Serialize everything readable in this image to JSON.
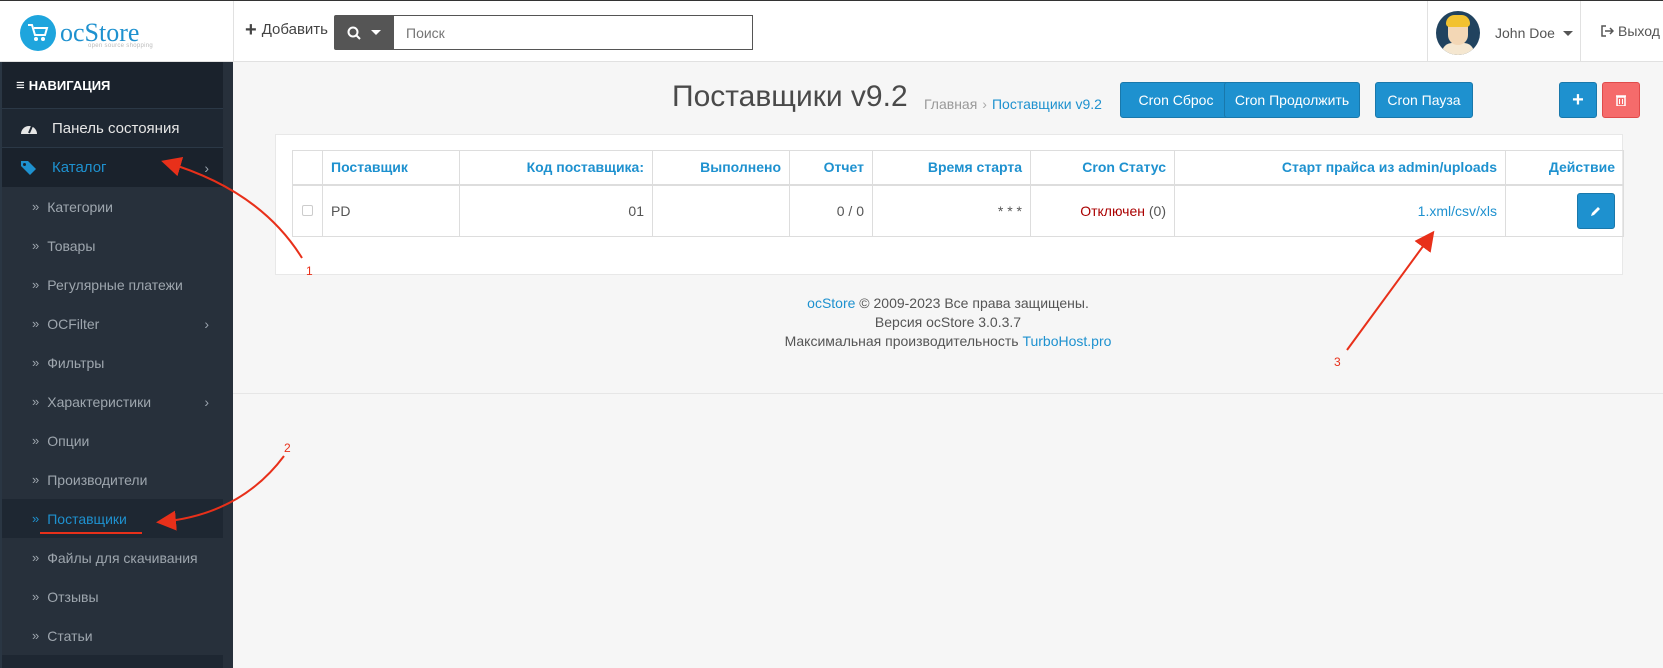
{
  "header": {
    "logo_text": "ocStore",
    "logo_sub": "open source shopping",
    "add_label": "Добавить",
    "search_placeholder": "Поиск",
    "user_name": "John Doe",
    "logout_label": "Выход"
  },
  "sidebar": {
    "nav_title": "НАВИГАЦИЯ",
    "dashboard": "Панель состояния",
    "catalog": "Каталог",
    "items": [
      {
        "label": "Категории",
        "has_children": false
      },
      {
        "label": "Товары",
        "has_children": false
      },
      {
        "label": "Регулярные платежи",
        "has_children": false
      },
      {
        "label": "OCFilter",
        "has_children": true
      },
      {
        "label": "Фильтры",
        "has_children": false
      },
      {
        "label": "Характеристики",
        "has_children": true
      },
      {
        "label": "Опции",
        "has_children": false
      },
      {
        "label": "Производители",
        "has_children": false
      },
      {
        "label": "Поставщики",
        "has_children": false,
        "active": true
      },
      {
        "label": "Файлы для скачивания",
        "has_children": false
      },
      {
        "label": "Отзывы",
        "has_children": false
      },
      {
        "label": "Статьи",
        "has_children": false
      }
    ]
  },
  "page": {
    "title": "Поставщики v9.2",
    "breadcrumb": [
      "Главная",
      "Поставщики v9.2"
    ],
    "buttons": {
      "cron_reset": "Cron Сброс",
      "cron_continue": "Cron Продолжить",
      "cron_pause": "Cron Пауза"
    }
  },
  "table": {
    "headers": [
      "Поставщик",
      "Код поставщика:",
      "Выполнено",
      "Отчет",
      "Время старта",
      "Cron Статус",
      "Старт прайса из admin/uploads",
      "Действие"
    ],
    "rows": [
      {
        "supplier": "PD",
        "code": "01",
        "done": "",
        "report": "0 / 0",
        "start_time": "* * *",
        "cron_status": "Отключен",
        "cron_count": "(0)",
        "price_start": "1.xml/csv/xls"
      }
    ]
  },
  "footer": {
    "brand": "ocStore",
    "copyright": "© 2009-2023 Все права защищены.",
    "version": "Версия ocStore 3.0.3.7",
    "performance": "Максимальная производительность",
    "host": "TurboHost.pro"
  },
  "annotations": [
    "1",
    "2",
    "3"
  ],
  "colors": {
    "accent": "#1e91cf",
    "danger": "#f56b6b",
    "sidebar_bg": "#1e2732",
    "annotation": "#e8301a"
  }
}
